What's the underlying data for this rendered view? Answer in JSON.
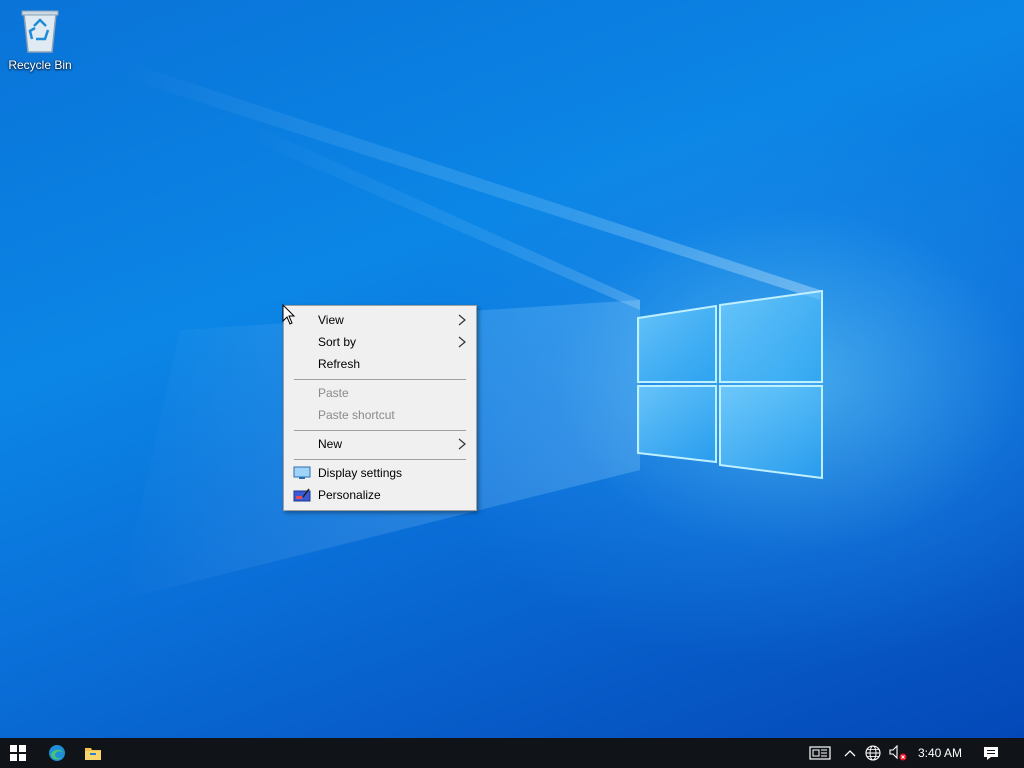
{
  "desktop": {
    "icons": [
      {
        "label": "Recycle Bin",
        "icon": "recycle-bin-icon"
      }
    ]
  },
  "context_menu": {
    "items": [
      {
        "label": "View",
        "has_submenu": true,
        "enabled": true
      },
      {
        "label": "Sort by",
        "has_submenu": true,
        "enabled": true
      },
      {
        "label": "Refresh",
        "has_submenu": false,
        "enabled": true
      },
      {
        "label": "Paste",
        "has_submenu": false,
        "enabled": false
      },
      {
        "label": "Paste shortcut",
        "has_submenu": false,
        "enabled": false
      },
      {
        "label": "New",
        "has_submenu": true,
        "enabled": true
      },
      {
        "label": "Display settings",
        "has_submenu": false,
        "enabled": true,
        "icon": "display-settings-icon"
      },
      {
        "label": "Personalize",
        "has_submenu": false,
        "enabled": true,
        "icon": "personalize-icon"
      }
    ]
  },
  "taskbar": {
    "start_icon": "windows-start-icon",
    "pinned": [
      "edge-browser-icon",
      "file-explorer-icon"
    ],
    "tray": {
      "icons": [
        "news-interests-icon",
        "show-hidden-icons-chevron",
        "network-globe-icon",
        "volume-muted-icon"
      ],
      "clock": "3:40 AM",
      "notification_icon": "action-center-icon"
    }
  },
  "colors": {
    "wallpaper_primary": "#0a73d8",
    "taskbar": "#101418",
    "menu_bg": "#f0f0f0",
    "disabled_text": "#8a8a8a"
  }
}
